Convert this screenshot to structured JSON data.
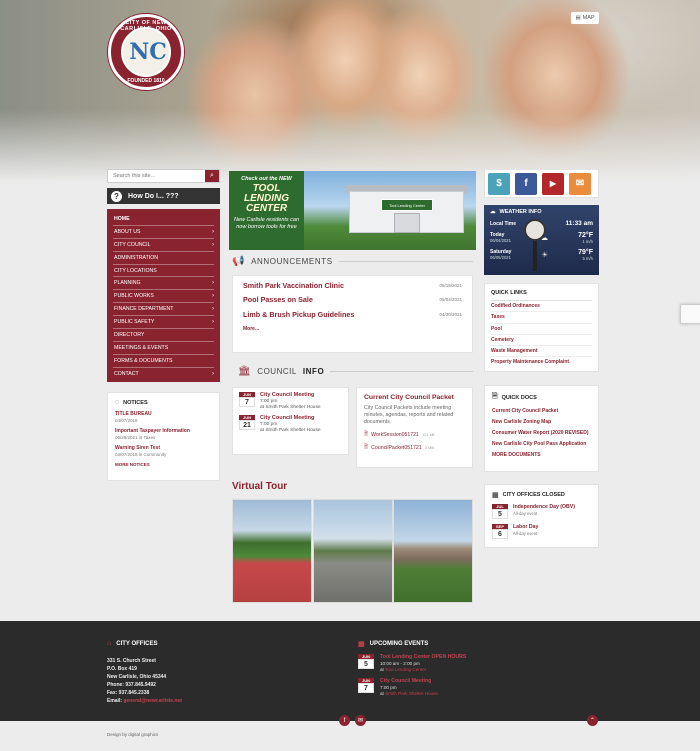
{
  "header": {
    "seal_top": "CITY OF NEW CARLISLE, OHIO",
    "seal_mid": "NC",
    "seal_bottom": "FOUNDED 1810",
    "map_label": "MAP"
  },
  "search": {
    "placeholder": "Search this site..."
  },
  "howdoi": {
    "label": "How Do I... ???"
  },
  "nav": {
    "items": [
      {
        "label": "HOME",
        "arrow": ""
      },
      {
        "label": "ABOUT US",
        "arrow": "›"
      },
      {
        "label": "CITY COUNCIL",
        "arrow": "›"
      },
      {
        "label": "ADMINISTRATION",
        "arrow": ""
      },
      {
        "label": "CITY LOCATIONS",
        "arrow": ""
      },
      {
        "label": "PLANNING",
        "arrow": "›"
      },
      {
        "label": "PUBLIC WORKS",
        "arrow": "›"
      },
      {
        "label": "FINANCE DEPARTMENT",
        "arrow": "›"
      },
      {
        "label": "PUBLIC SAFETY",
        "arrow": "›"
      },
      {
        "label": "DIRECTORY",
        "arrow": ""
      },
      {
        "label": "MEETINGS & EVENTS",
        "arrow": ""
      },
      {
        "label": "FORMS & DOCUMENTS",
        "arrow": ""
      },
      {
        "label": "CONTACT",
        "arrow": "›"
      }
    ]
  },
  "notices": {
    "title": "NOTICES",
    "items": [
      {
        "title": "TITLE BUREAU",
        "date": "04/07/2018"
      },
      {
        "title": "Important Taxpayer Information",
        "date": "06/28/2021 in Taxes"
      },
      {
        "title": "Warning Siren Test",
        "date": "04/07/2018 in Community"
      }
    ],
    "more": "MORE NOTICES"
  },
  "banner": {
    "line1": "Check out the NEW",
    "line2": "TOOL LENDING CENTER",
    "line3": "New Carlisle residents can now borrow tools for free",
    "sign": "Tool Lending Center"
  },
  "announcements": {
    "title": "ANNOUNCEMENTS",
    "items": [
      {
        "title": "Smith Park Vaccination Clinic",
        "date": "05/18/2021"
      },
      {
        "title": "Pool Passes on Sale",
        "date": "05/04/2021"
      },
      {
        "title": "Limb & Brush Pickup Guidelines",
        "date": "04/30/2021"
      }
    ],
    "more": "More..."
  },
  "council": {
    "title_a": "COUNCIL",
    "title_b": "INFO",
    "meetings": [
      {
        "month": "JUN",
        "day": "7",
        "title": "City Council Meeting",
        "time": "7:00 pm",
        "loc": "at Smith Park Shelter House"
      },
      {
        "month": "JUN",
        "day": "21",
        "title": "City Council Meeting",
        "time": "7:00 pm",
        "loc": "at Smith Park Shelter House"
      }
    ],
    "packet_title": "Current City Council Packet",
    "packet_text": "City Council Packets include meeting minutes, agendas, reports and related documents.",
    "files": [
      {
        "name": "WorkSession051721",
        "size": "121 kB"
      },
      {
        "name": "CouncilPacket051721",
        "size": "3 MB"
      }
    ]
  },
  "virtual_tour": {
    "title": "Virtual Tour"
  },
  "social": {
    "icons": [
      "dollar-icon",
      "facebook-icon",
      "youtube-icon",
      "email-icon"
    ],
    "fb": "f",
    "yt": "▶",
    "mail": "✉",
    "pay": "$"
  },
  "weather": {
    "title": "WEATHER INFO",
    "local_label": "Local Time",
    "local_time": "11:33 am",
    "today_label": "Today",
    "today_date": "06/04/2021",
    "today_temp": "72°F",
    "today_wind": "1 m/h",
    "sat_label": "Saturday",
    "sat_date": "06/05/2021",
    "sat_temp": "79°F",
    "sat_wind": "5 m/h"
  },
  "quick_links": {
    "title": "QUICK LINKS",
    "items": [
      "Codified Ordinances",
      "Taxes",
      "Pool",
      "Cemetery",
      "Waste Management",
      "Property Maintenance Complaint"
    ]
  },
  "quick_docs": {
    "title": "QUICK DOCS",
    "items": [
      "Current City Council Packet",
      "New Carlisle Zoning Map",
      "Consumer Water Report (2020 REVISED)",
      "New Carlisle City Pool Pass Application"
    ],
    "more": "MORE DOCUMENTS"
  },
  "offices_closed": {
    "title": "CITY OFFICES CLOSED",
    "items": [
      {
        "month": "JUL",
        "day": "5",
        "title": "Independence Day (OBV)",
        "sub": "All-day event"
      },
      {
        "month": "SEP",
        "day": "6",
        "title": "Labor Day",
        "sub": "All-day event"
      }
    ]
  },
  "footer": {
    "office_title": "CITY OFFICES",
    "address": [
      "331 S. Church Street",
      "P.O. Box 419",
      "New Carlisle, Ohio 45344",
      "Phone: 937.845.9492",
      "Fax: 937.845.2338"
    ],
    "email_label": "Email:",
    "email": "general@newcarlisle.net",
    "events_title": "UPCOMING EVENTS",
    "events": [
      {
        "month": "JUN",
        "day": "5",
        "title": "Tool Lending Center OPEN HOURS",
        "time": "10:00 am - 2:00 pm",
        "at": "at",
        "loc": "Tool Lending Center"
      },
      {
        "month": "JUN",
        "day": "7",
        "title": "City Council Meeting",
        "time": "7:00 pm",
        "at": "at",
        "loc": "Smith Park Shelter House"
      }
    ],
    "credit": "Design by digital graphics",
    "fb": "f",
    "mail": "✉",
    "top": "⌃"
  },
  "colors": {
    "brand": "#8a2330",
    "footer": "#2b2b2b"
  }
}
